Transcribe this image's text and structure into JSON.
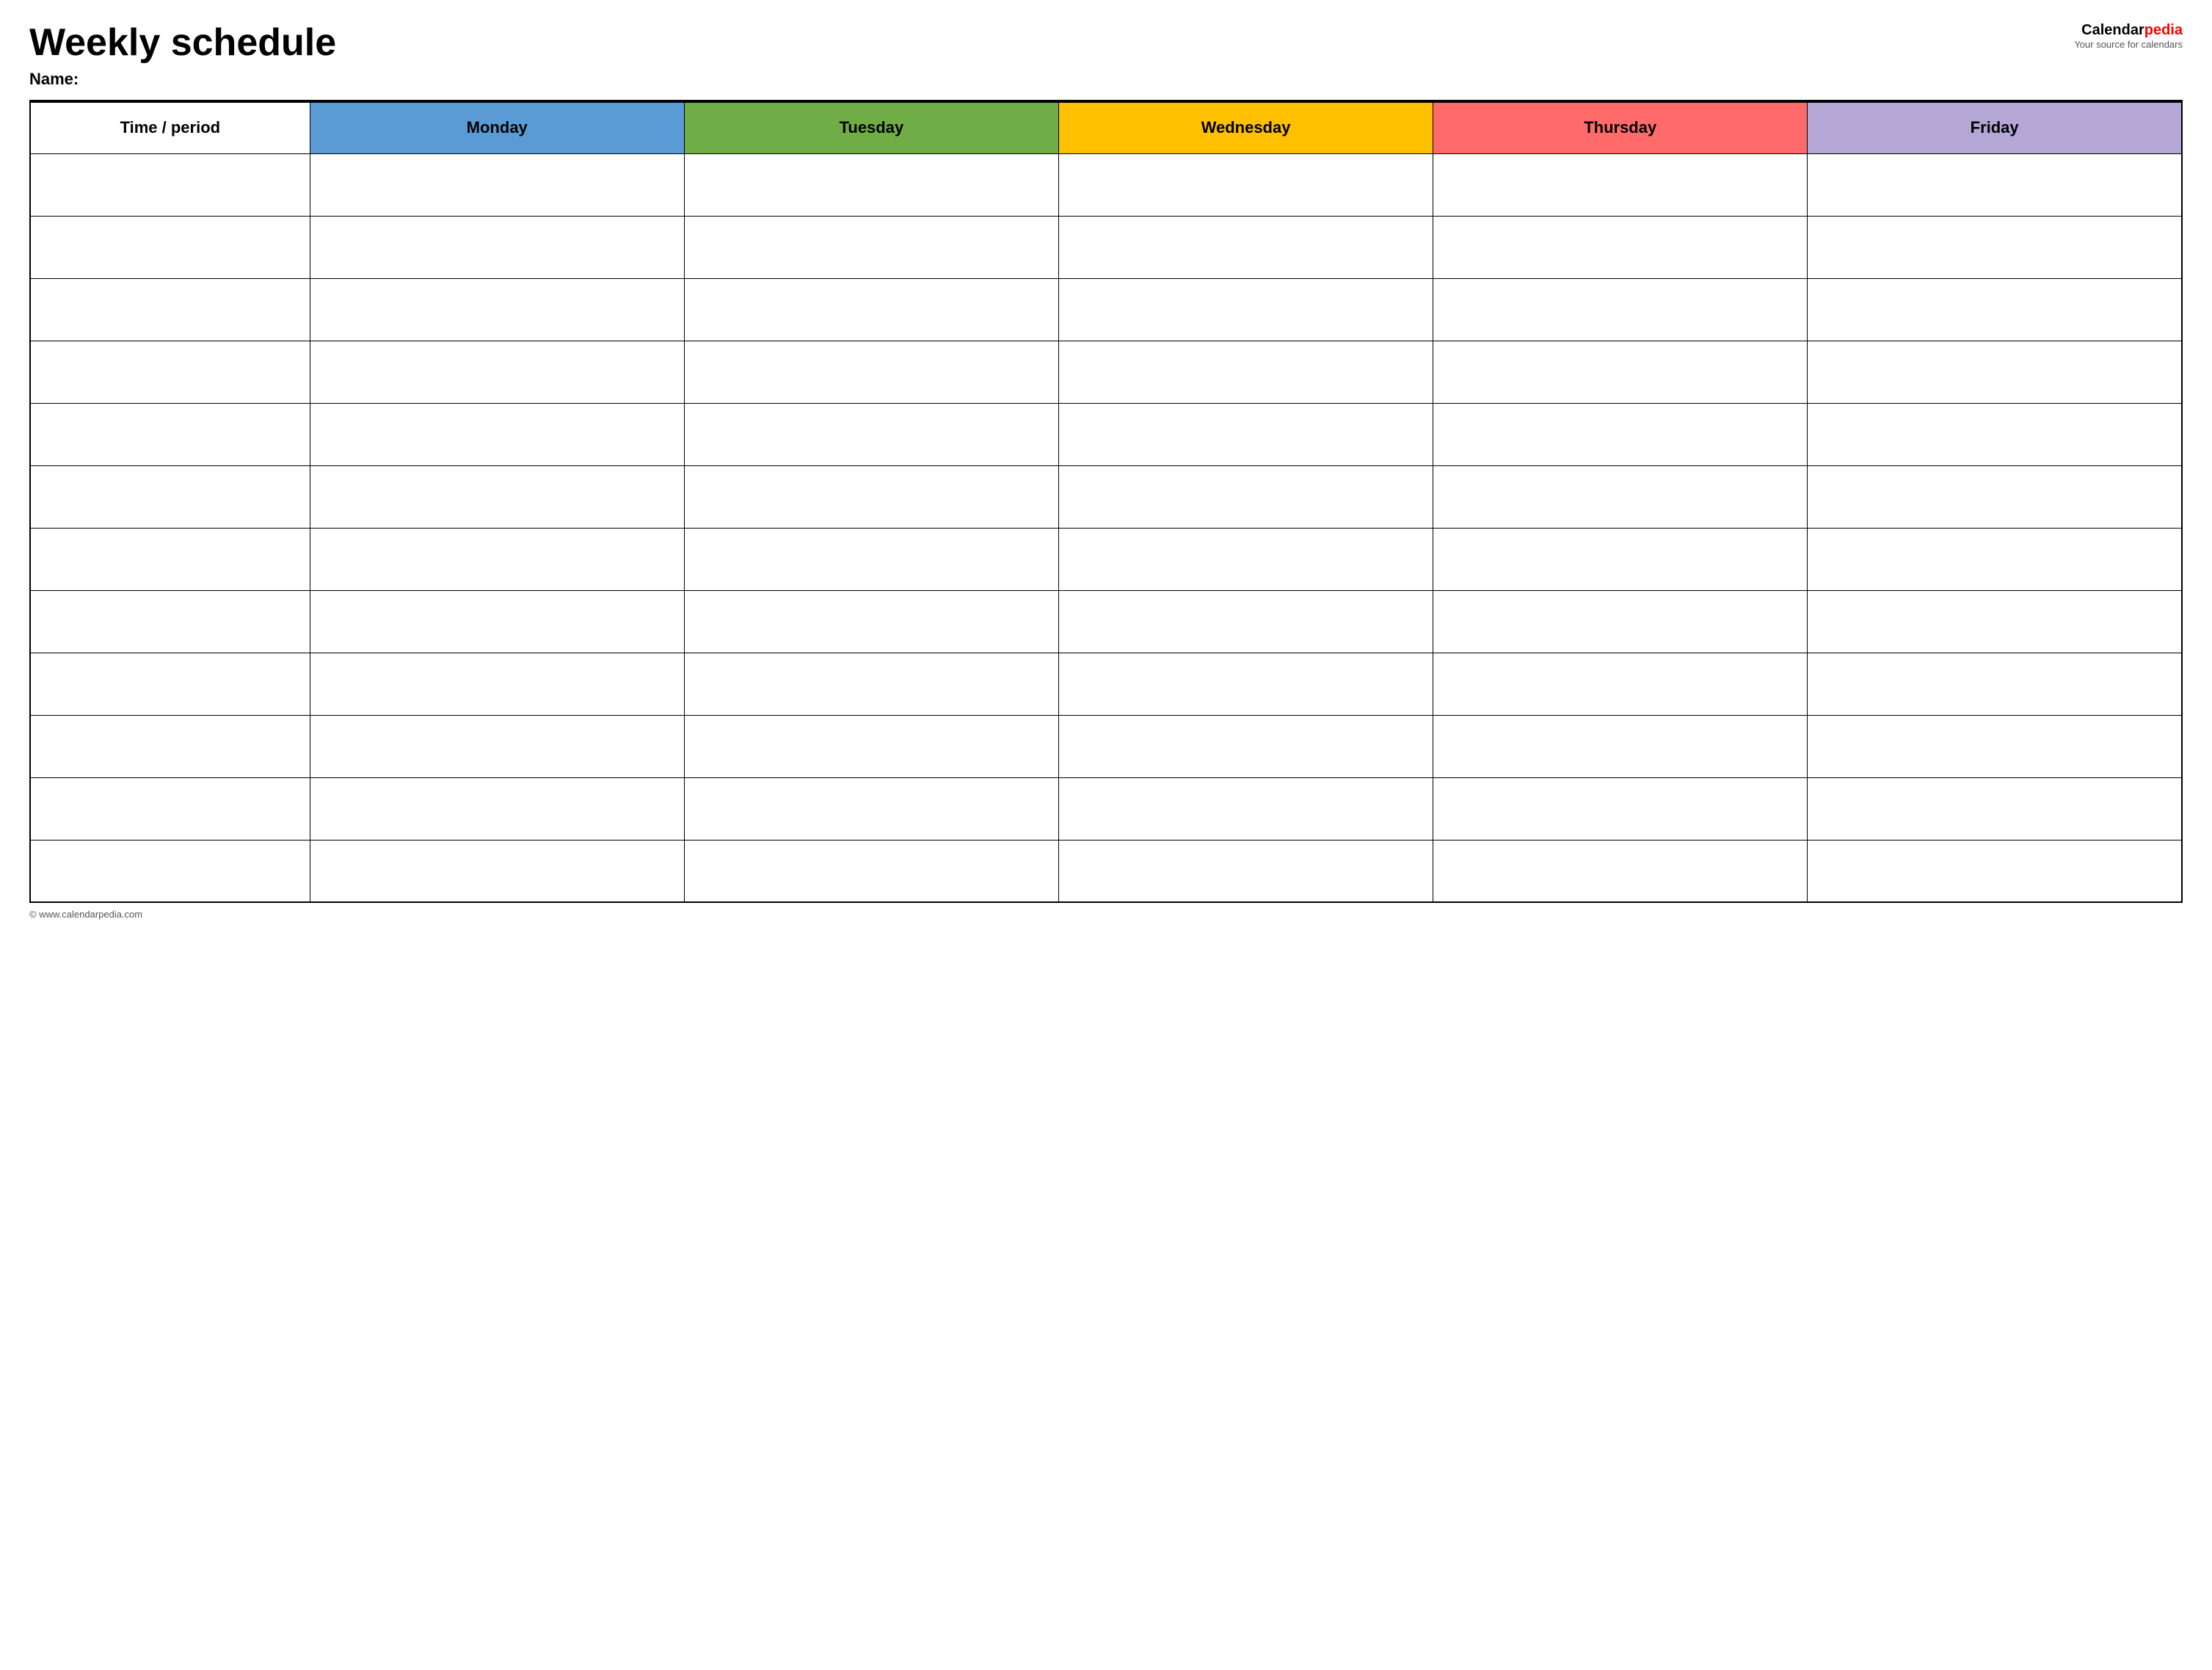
{
  "header": {
    "title": "Weekly schedule",
    "name_label": "Name:",
    "logo_brand": "Calendar",
    "logo_pedia": "pedia",
    "logo_subtitle": "Your source for calendars"
  },
  "table": {
    "columns": [
      {
        "id": "time",
        "label": "Time / period",
        "class": "th-time"
      },
      {
        "id": "monday",
        "label": "Monday",
        "class": "th-monday"
      },
      {
        "id": "tuesday",
        "label": "Tuesday",
        "class": "th-tuesday"
      },
      {
        "id": "wednesday",
        "label": "Wednesday",
        "class": "th-wednesday"
      },
      {
        "id": "thursday",
        "label": "Thursday",
        "class": "th-thursday"
      },
      {
        "id": "friday",
        "label": "Friday",
        "class": "th-friday"
      }
    ],
    "row_count": 12
  },
  "footer": {
    "copyright": "© www.calendarpedia.com"
  }
}
